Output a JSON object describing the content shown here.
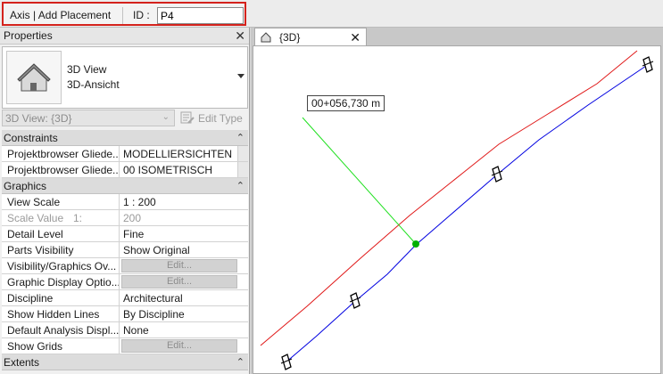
{
  "options_bar": {
    "command": "Axis | Add Placement",
    "id_label": "ID :",
    "id_value": "P4",
    "highlight_color": "#d4221c"
  },
  "properties": {
    "title": "Properties",
    "close": "✕",
    "type_name": "3D View",
    "type_subname": "3D-Ansicht",
    "view_selector": "3D View: {3D}",
    "edit_type": "Edit Type",
    "groups": {
      "constraints": "Constraints",
      "graphics": "Graphics",
      "extents": "Extents"
    },
    "constraints_rows": [
      {
        "name": "Projektbrowser Gliede...",
        "value": "MODELLIERSICHTEN"
      },
      {
        "name": "Projektbrowser Gliede...",
        "value": "00 ISOMETRISCH"
      }
    ],
    "graphics_rows": [
      {
        "name": "View Scale",
        "value": "1 : 200"
      },
      {
        "name": "Scale Value",
        "extra": "1:",
        "value": "200"
      },
      {
        "name": "Detail Level",
        "value": "Fine"
      },
      {
        "name": "Parts Visibility",
        "value": "Show Original"
      },
      {
        "name": "Visibility/Graphics Ov...",
        "value": "Edit..."
      },
      {
        "name": "Graphic Display Optio...",
        "value": "Edit..."
      },
      {
        "name": "Discipline",
        "value": "Architectural"
      },
      {
        "name": "Show Hidden Lines",
        "value": "By Discipline"
      },
      {
        "name": "Default Analysis Displ...",
        "value": "None"
      },
      {
        "name": "Show Grids",
        "value": "Edit..."
      }
    ]
  },
  "view": {
    "tab_label": "{3D}",
    "tab_close": "✕",
    "station_label": "00+056,730 m",
    "line_colors": {
      "alignment": "#0000e0",
      "offset": "#e01818",
      "leader": "#1ee01e",
      "marker": "#00b000"
    }
  }
}
